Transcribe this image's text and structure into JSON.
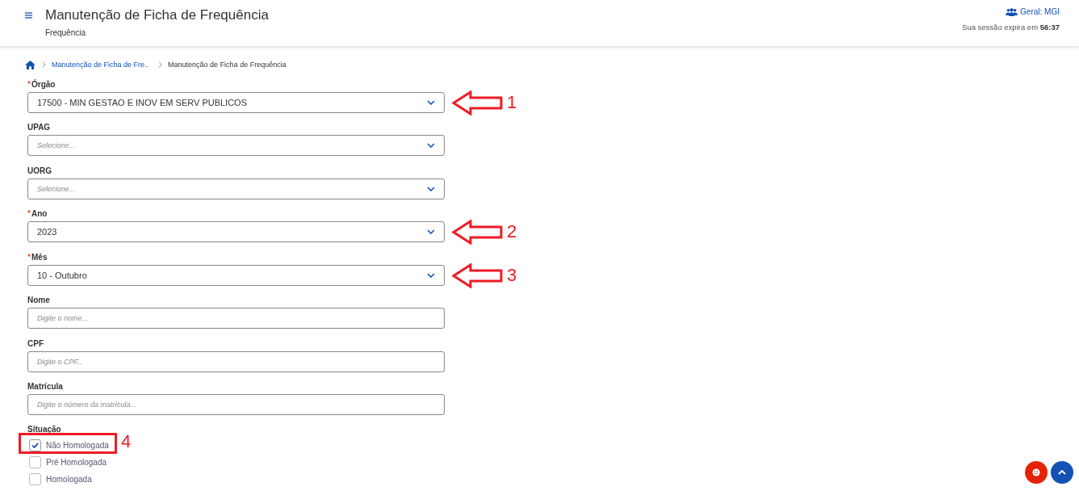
{
  "header": {
    "title": "Manutenção de Ficha de Frequência",
    "subtitle": "Frequência",
    "profile": "Geral: MGI",
    "session": "Sua sessão expira em **56:37**"
  },
  "breadcrumb": [
    {
      "label": "Manutenção de Ficha de Fre..",
      "kind": "link"
    },
    {
      "label": "Manutenção de Ficha de Frequência",
      "kind": "current"
    }
  ],
  "form": {
    "fields": [
      {
        "label": "Órgão",
        "required": true,
        "kind": "select",
        "value": "17500 - MIN GESTAO E INOV EM SERV PUBLICOS",
        "annotation": "1"
      },
      {
        "label": "UPAG",
        "required": false,
        "kind": "select",
        "placeholder": "Selecione..."
      },
      {
        "label": "UORG",
        "required": false,
        "kind": "select",
        "placeholder": "Selecione..."
      },
      {
        "label": "Ano",
        "required": true,
        "kind": "select",
        "value": "2023",
        "annotation": "2"
      },
      {
        "label": "Mês",
        "required": true,
        "kind": "select",
        "value": "10 - Outubro",
        "annotation": "3"
      },
      {
        "label": "Nome",
        "required": false,
        "kind": "input",
        "placeholder": "Digite o nome..."
      },
      {
        "label": "CPF",
        "required": false,
        "kind": "input",
        "placeholder": "Digite o CPF..."
      },
      {
        "label": "Matrícula",
        "required": false,
        "kind": "input",
        "placeholder": "Digite o número da matrícula..."
      }
    ],
    "situacao": {
      "label": "Situação",
      "options": [
        {
          "label": "Não Homologada",
          "checked": true,
          "annotation": "4"
        },
        {
          "label": "Pré Homologada",
          "checked": false
        },
        {
          "label": "Homologada",
          "checked": false
        }
      ]
    }
  }
}
